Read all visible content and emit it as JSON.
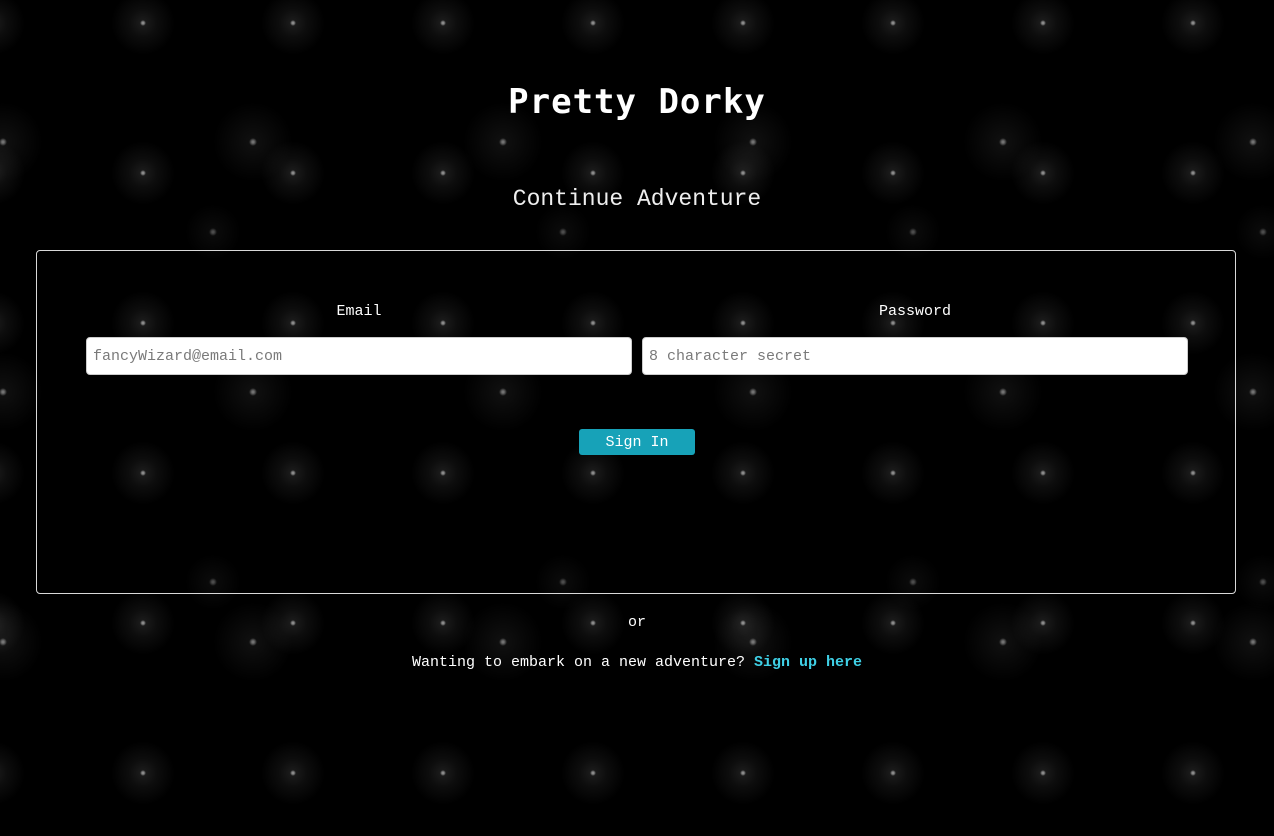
{
  "brand": {
    "title": "Pretty Dorky"
  },
  "page": {
    "subtitle": "Continue Adventure"
  },
  "form": {
    "email": {
      "label": "Email",
      "value": "",
      "placeholder": "fancyWizard@email.com"
    },
    "password": {
      "label": "Password",
      "value": "",
      "placeholder": "8 character secret"
    },
    "submit_label": "Sign In"
  },
  "footer": {
    "or_text": "or",
    "prompt": "Wanting to embark on a new adventure?",
    "signup_link": "Sign up here"
  },
  "colors": {
    "background": "#000000",
    "accent_button": "#17a2b8",
    "link": "#3fd0e6",
    "card_border": "#d9d9d9"
  }
}
